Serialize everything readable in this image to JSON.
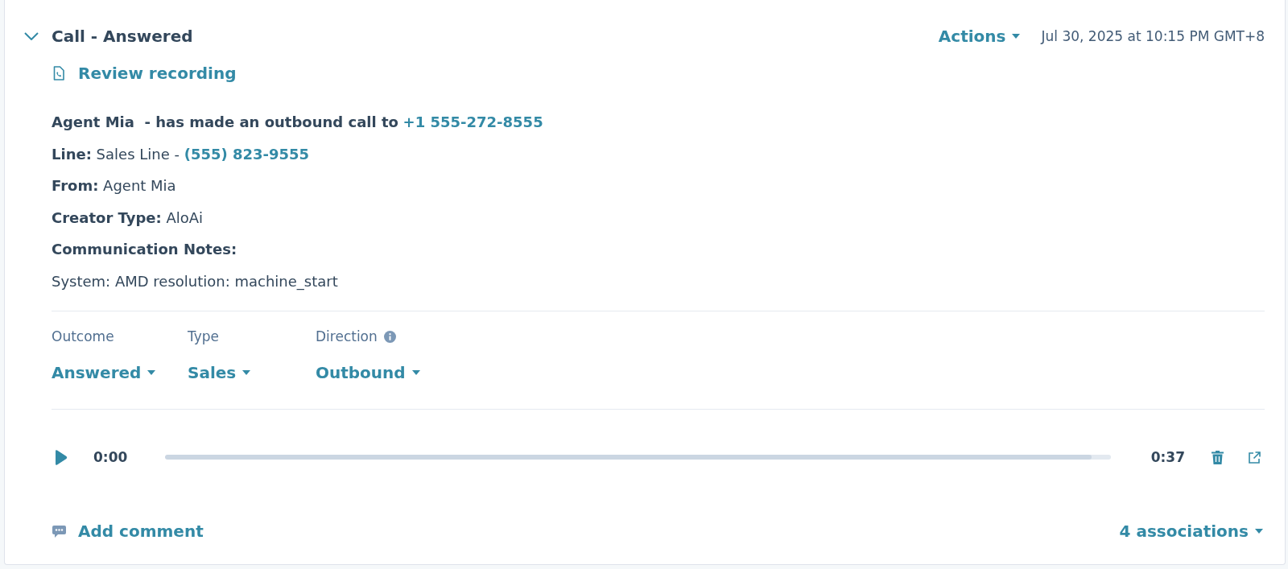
{
  "header": {
    "expanded": true,
    "title": "Call - Answered",
    "actions": "Actions",
    "timestamp": "Jul 30, 2025 at 10:15 PM GMT+8"
  },
  "recording_link": "Review recording",
  "summary": {
    "text": "Agent Mia  - has made an outbound call to",
    "phone": "+1 555-272-8555"
  },
  "details": [
    {
      "label": "Line:",
      "value": "Sales Line -",
      "phone": "(555) 823-9555"
    },
    {
      "label": "From:",
      "value": "Agent Mia"
    },
    {
      "label": "Creator Type:",
      "value": "AloAi"
    },
    {
      "label": "Communication Notes:"
    }
  ],
  "notes": "System: AMD resolution: machine_start",
  "properties": [
    {
      "label": "Outcome",
      "value": "Answered",
      "info": false
    },
    {
      "label": "Type",
      "value": "Sales",
      "info": false
    },
    {
      "label": "Direction",
      "value": "Outbound",
      "info": true
    }
  ],
  "player": {
    "elapsed": "0:00",
    "level": 0.98,
    "duration": "0:37"
  },
  "footer": {
    "comment": "Add comment",
    "associations": "4 associations"
  }
}
